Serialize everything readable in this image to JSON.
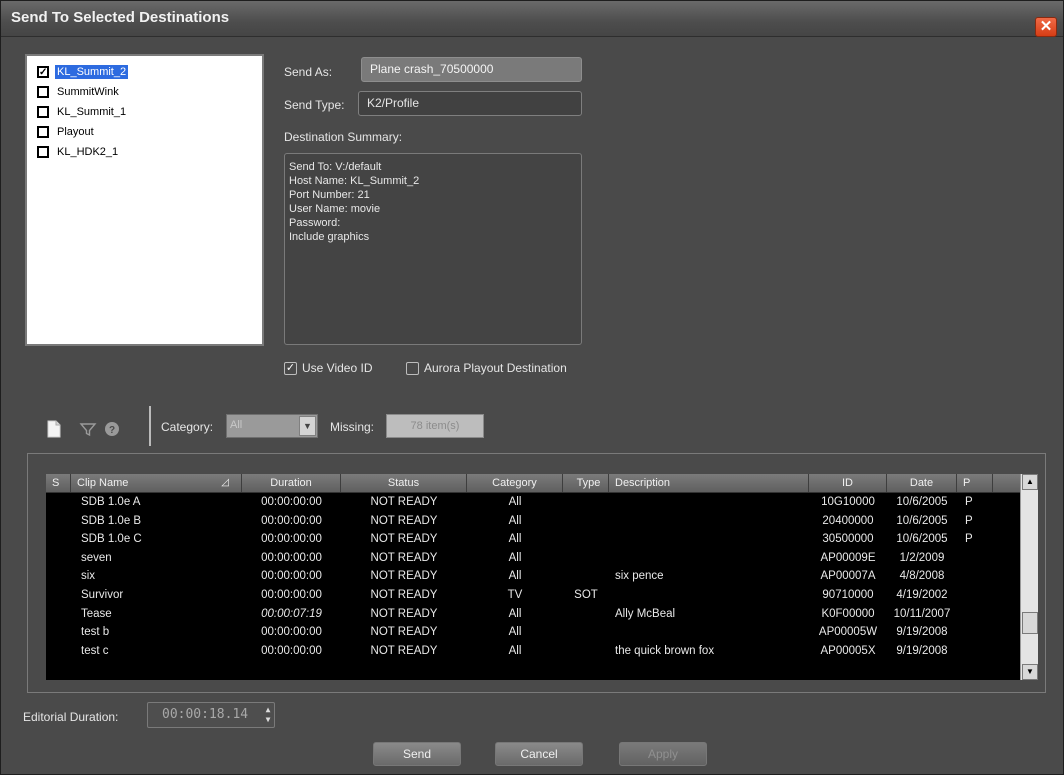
{
  "window": {
    "title": "Send To Selected Destinations",
    "close_glyph": "✕"
  },
  "destinations": [
    {
      "label": "KL_Summit_2",
      "checked": true,
      "selected": true
    },
    {
      "label": "SummitWink",
      "checked": false,
      "selected": false
    },
    {
      "label": "KL_Summit_1",
      "checked": false,
      "selected": false
    },
    {
      "label": "Playout",
      "checked": false,
      "selected": false
    },
    {
      "label": "KL_HDK2_1",
      "checked": false,
      "selected": false
    }
  ],
  "form": {
    "send_as_label": "Send As:",
    "send_as_value": "Plane crash_70500000",
    "send_type_label": "Send Type:",
    "send_type_value": "K2/Profile",
    "summary_label": "Destination Summary:",
    "summary_lines": [
      "Send To: V:/default",
      "Host Name: KL_Summit_2",
      "Port Number: 21",
      "User Name: movie",
      "Password:",
      "Include graphics"
    ],
    "use_video_id_label": "Use Video ID",
    "use_video_id_checked": true,
    "aurora_label": "Aurora Playout Destination",
    "aurora_checked": false
  },
  "toolbar": {
    "icons": [
      "new-document-icon",
      "filter-icon",
      "help-icon"
    ],
    "category_label": "Category:",
    "category_value": "All",
    "missing_label": "Missing:",
    "missing_value": "78 item(s)"
  },
  "table": {
    "columns": [
      "S",
      "Clip Name",
      "Duration",
      "Status",
      "Category",
      "Type",
      "Description",
      "ID",
      "Date",
      "P"
    ],
    "rows": [
      {
        "s": "",
        "name": "SDB 1.0e A",
        "duration": "00:00:00:00",
        "status": "NOT READY",
        "category": "All",
        "type": "",
        "description": "",
        "id": "10G10000",
        "date": "10/6/2005",
        "p": "P"
      },
      {
        "s": "",
        "name": "SDB 1.0e B",
        "duration": "00:00:00:00",
        "status": "NOT READY",
        "category": "All",
        "type": "",
        "description": "",
        "id": "20400000",
        "date": "10/6/2005",
        "p": "P"
      },
      {
        "s": "",
        "name": "SDB 1.0e C",
        "duration": "00:00:00:00",
        "status": "NOT READY",
        "category": "All",
        "type": "",
        "description": "",
        "id": "30500000",
        "date": "10/6/2005",
        "p": "P"
      },
      {
        "s": "",
        "name": "seven",
        "duration": "00:00:00:00",
        "status": "NOT READY",
        "category": "All",
        "type": "",
        "description": "",
        "id": "AP00009E",
        "date": "1/2/2009",
        "p": ""
      },
      {
        "s": "",
        "name": "six",
        "duration": "00:00:00:00",
        "status": "NOT READY",
        "category": "All",
        "type": "",
        "description": "six pence",
        "id": "AP00007A",
        "date": "4/8/2008",
        "p": ""
      },
      {
        "s": "",
        "name": "Survivor",
        "duration": "00:00:00:00",
        "status": "NOT READY",
        "category": "TV",
        "type": "SOT",
        "description": "",
        "id": "90710000",
        "date": "4/19/2002",
        "p": ""
      },
      {
        "s": "",
        "name": "Tease",
        "duration": "00:00:07:19",
        "status": "NOT READY",
        "category": "All",
        "type": "",
        "description": "Ally McBeal",
        "id": "K0F00000",
        "date": "10/11/2007",
        "p": "",
        "italic": true
      },
      {
        "s": "",
        "name": "test b",
        "duration": "00:00:00:00",
        "status": "NOT READY",
        "category": "All",
        "type": "",
        "description": "",
        "id": "AP00005W",
        "date": "9/19/2008",
        "p": ""
      },
      {
        "s": "",
        "name": "test c",
        "duration": "00:00:00:00",
        "status": "NOT READY",
        "category": "All",
        "type": "",
        "description": "the quick brown fox",
        "id": "AP00005X",
        "date": "9/19/2008",
        "p": ""
      }
    ],
    "sort_glyph": "◿"
  },
  "editorial": {
    "label": "Editorial Duration:",
    "value": "00:00:18.14"
  },
  "buttons": {
    "send": "Send",
    "cancel": "Cancel",
    "apply": "Apply"
  }
}
